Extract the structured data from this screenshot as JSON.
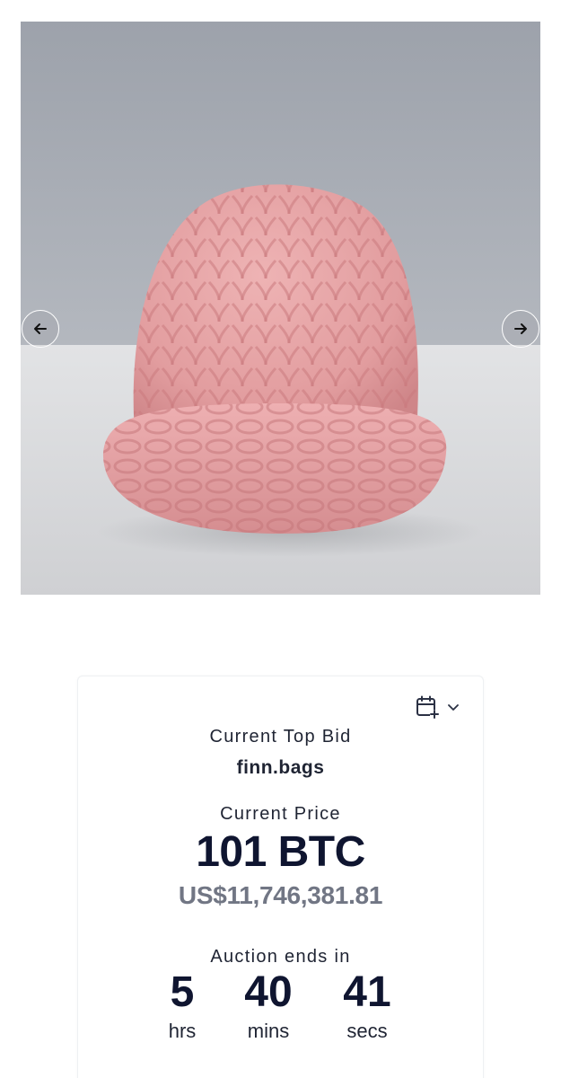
{
  "carousel": {
    "image_alt": "pink knitted beanie",
    "prev_icon": "arrow-left-icon",
    "next_icon": "arrow-right-icon"
  },
  "auction": {
    "calendar_icon": "calendar-plus-icon",
    "dropdown_icon": "chevron-down-icon",
    "top_bid_label": "Current Top Bid",
    "top_bidder": "finn.bags",
    "price_label": "Current Price",
    "price": "101 BTC",
    "price_usd": "US$11,746,381.81",
    "ends_label": "Auction ends in",
    "countdown": [
      {
        "value": "5",
        "unit": "hrs"
      },
      {
        "value": "40",
        "unit": "mins"
      },
      {
        "value": "41",
        "unit": "secs"
      }
    ]
  },
  "colors": {
    "text_dark": "#0f1530",
    "text_muted": "#717684",
    "beanie_pink": "#e6a3a6"
  }
}
